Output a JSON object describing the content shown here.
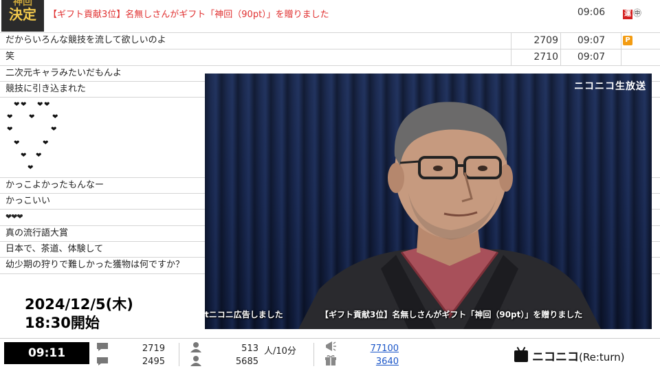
{
  "gift_comment": {
    "badge_line1": "神回",
    "badge_line2": "決定",
    "text": "【ギフト貢献3位】名無しさんがギフト「神回（90pt）」を贈りました",
    "time": "09:06",
    "icon_un": "運",
    "icon_gift": "㊥"
  },
  "comments": [
    {
      "text": "だからいろんな競技を流して欲しいのよ",
      "no": "2709",
      "time": "09:07",
      "badge": "P"
    },
    {
      "text": "笑",
      "no": "2710",
      "time": "09:07"
    },
    {
      "text": "二次元キャラみたいだもんよ"
    },
    {
      "text": "競技に引き込まれた"
    },
    {
      "text": "かっこよかったもんなー"
    },
    {
      "text": "かっこいい"
    },
    {
      "text": "❤❤❤"
    },
    {
      "text": "真の流行語大賞"
    },
    {
      "text": "日本で、茶道、体験して"
    },
    {
      "text": "幼少期の狩りで難しかった獲物は何ですか？"
    }
  ],
  "heart_glyph": "❤",
  "video": {
    "logo": "ニコニコ生放送",
    "ticker_a": "tニコニ広告しました",
    "ticker_b": "【ギフト貢献3位】名無しさんがギフト「神回（90pt）」を贈りました"
  },
  "date_block": {
    "line1": "2024/12/5(木)",
    "line2": "18:30開始"
  },
  "statusbar": {
    "clock": "09:11",
    "comments_total": "2719",
    "comments_sub": "2495",
    "viewers_now": "513",
    "viewers_unit": "人/10分",
    "viewers_total": "5685",
    "ad_points": "77100",
    "gift_points": "3640",
    "brand_main": "ニコニコ",
    "brand_sub": "(Re:turn)"
  },
  "colors": {
    "gift_text": "#e03030",
    "link": "#1a55c8",
    "video_bg": "#1d2c52"
  }
}
